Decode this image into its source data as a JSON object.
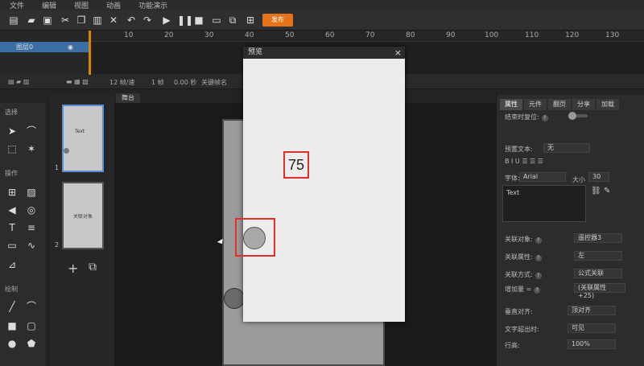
{
  "menu": [
    "文件",
    "编辑",
    "视图",
    "动画",
    "功能演示"
  ],
  "toolbar": {
    "publish_label": "发布"
  },
  "timeline": {
    "ticks": [
      "10",
      "20",
      "30",
      "40",
      "50",
      "60",
      "70",
      "80",
      "90",
      "100",
      "110",
      "120",
      "130"
    ],
    "layer_name": "图层0",
    "fps": "12 帧/速",
    "frame": "1 帧",
    "time": "0.00 秒",
    "keyframe_label": "关键帧名"
  },
  "left_panel": {
    "select_title": "选择",
    "operate_title": "操作",
    "draw_title": "绘制"
  },
  "thumbnails": [
    {
      "num": "1",
      "text": "Text"
    },
    {
      "num": "2",
      "text": "关联对象"
    }
  ],
  "stage": {
    "tab_label": "舞台"
  },
  "preview": {
    "title": "预览",
    "close": "×",
    "number": "75"
  },
  "properties": {
    "tabs": [
      "属性",
      "元件",
      "翻页",
      "分享",
      "加载"
    ],
    "reset_label": "结束时复位:",
    "preset_text_label": "预置文本:",
    "preset_text_value": "无",
    "font_label": "字体:",
    "font_value": "Arial",
    "size_label": "大小",
    "size_value": "30",
    "text_value": "Text",
    "link_object_label": "关联对象:",
    "link_object_value": "遥控器3",
    "link_prop_label": "关联属性:",
    "link_prop_value": "左",
    "link_mode_label": "关联方式:",
    "link_mode_value": "公式关联",
    "offset_label": "增加量 =",
    "offset_value": "(关联属性+25)",
    "valign_label": "垂直对齐:",
    "valign_value": "顶对齐",
    "overflow_label": "文字超出时:",
    "overflow_value": "可见",
    "lineheight_label": "行高:",
    "lineheight_value": "100%"
  }
}
